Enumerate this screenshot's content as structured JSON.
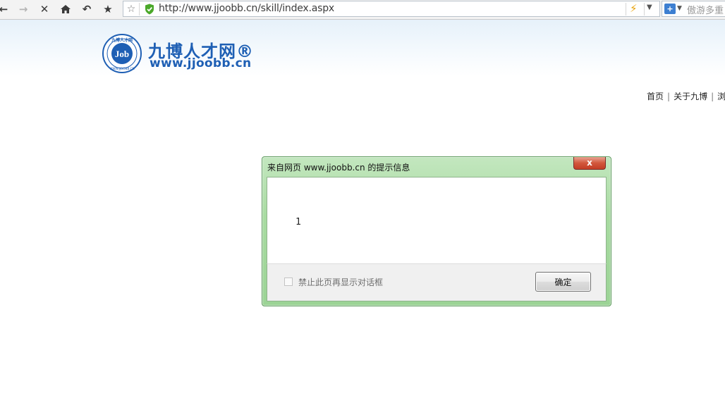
{
  "browser": {
    "url": "http://www.jjoobb.cn/skill/index.aspx",
    "search_placeholder": "傲游多重"
  },
  "site": {
    "logo_text": "九博人才网®",
    "logo_url_text": "www.jjoobb.cn",
    "seal_top_text": "九博人才网",
    "seal_center_text": "Job",
    "seal_bottom_text": "WWW.JJOOBB.CN",
    "nav": {
      "home": "首页",
      "about": "关于九博",
      "browse": "浏"
    }
  },
  "dialog": {
    "title": "来自网页 www.jjoobb.cn 的提示信息",
    "close_label": "x",
    "message": "1",
    "suppress_label": "禁止此页再显示对话框",
    "ok_label": "确定"
  },
  "colors": {
    "brand_blue": "#1e5fb4",
    "dialog_green": "#a8dba1",
    "close_red": "#d2573c"
  }
}
